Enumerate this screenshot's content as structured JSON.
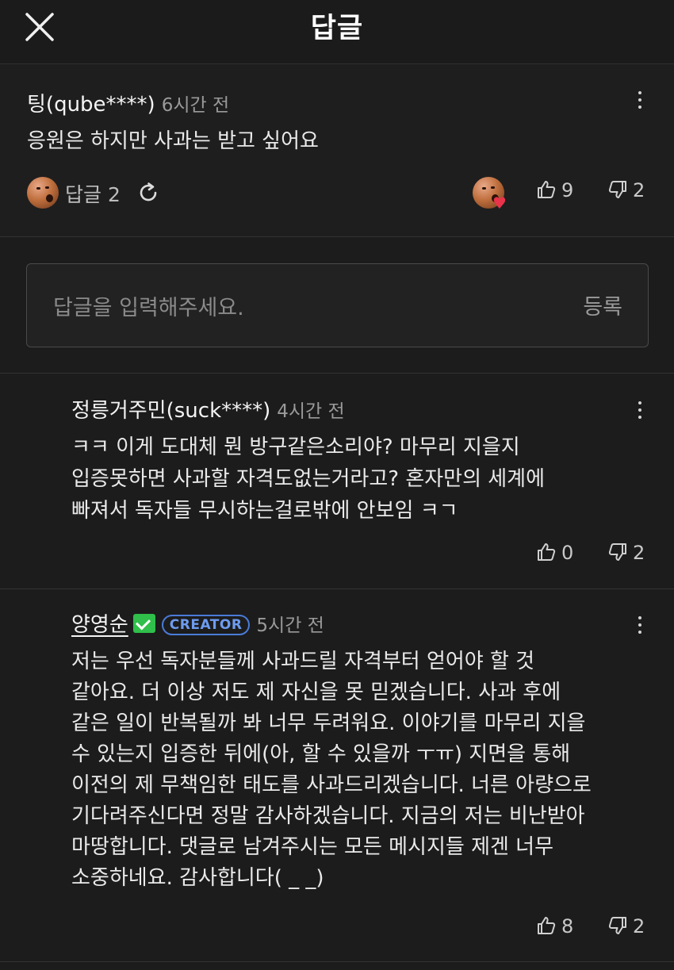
{
  "header": {
    "title": "답글"
  },
  "parent": {
    "author": "팅(qube****)",
    "time": "6시간 전",
    "text": "응원은 하지만 사과는 받고 싶어요",
    "reply_count": "답글 2",
    "likes": "9",
    "dislikes": "2"
  },
  "reply_input": {
    "placeholder": "답글을 입력해주세요.",
    "submit_label": "등록"
  },
  "replies": [
    {
      "author": "정릉거주민(suck****)",
      "time": "4시간 전",
      "lines": [
        "ㅋㅋ 이게 도대체 뭔 방구같은소리야? 마무리 지을지",
        "입증못하면 사과할 자격도없는거라고? 혼자만의 세계에",
        "빠져서 독자들 무시하는걸로밖에 안보임 ㅋㄱ"
      ],
      "likes": "0",
      "dislikes": "2"
    },
    {
      "author": "양영순",
      "badge": "CREATOR",
      "time": "5시간 전",
      "lines": [
        "저는 우선 독자분들께 사과드릴 자격부터 얻어야 할 것",
        "같아요. 더 이상 저도 제 자신을 못 믿겠습니다. 사과 후에",
        "같은 일이 반복될까 봐 너무 두려워요. 이야기를 마무리 지을",
        "수 있는지 입증한 뒤에(아, 할 수 있을까 ㅜㅠ) 지면을 통해",
        "이전의 제 무책임한 태도를 사과드리겠습니다. 너른 아량으로",
        "기다려주신다면 정말 감사하겠습니다. 지금의 저는 비난받아",
        "마땅합니다. 댓글로 남겨주시는 모든 메시지들 제겐 너무",
        "소중하네요. 감사합니다( _ _)"
      ],
      "likes": "8",
      "dislikes": "2"
    }
  ],
  "colors": {
    "background": "#1c1c1c",
    "text": "#f2f2f2",
    "muted": "#9a9a9a",
    "verified": "#2fbf4a",
    "creator": "#4a7bd8",
    "heart": "#e8334a"
  },
  "icons": [
    "close-icon",
    "more-vertical-icon",
    "refresh-icon",
    "thumbs-up-icon",
    "thumbs-down-icon",
    "verified-icon",
    "heart-icon"
  ]
}
